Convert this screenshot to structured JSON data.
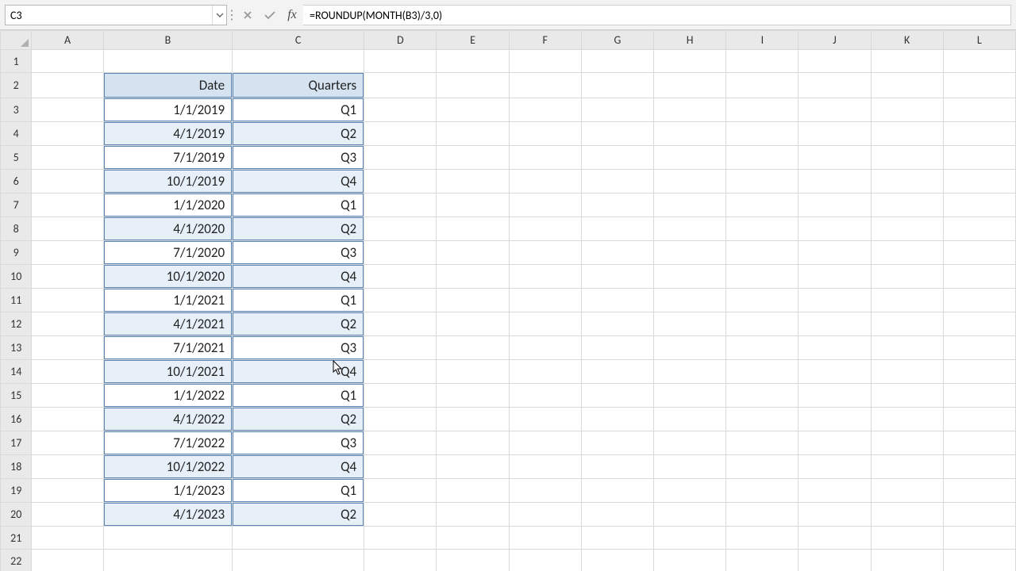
{
  "namebox": {
    "value": "C3"
  },
  "formula_bar": {
    "fx_label": "fx",
    "formula": "=ROUNDUP(MONTH(B3)/3,0)"
  },
  "columns": [
    "A",
    "B",
    "C",
    "D",
    "E",
    "F",
    "G",
    "H",
    "I",
    "J",
    "K",
    "L"
  ],
  "rows": [
    "1",
    "2",
    "3",
    "4",
    "5",
    "6",
    "7",
    "8",
    "9",
    "10",
    "11",
    "12",
    "13",
    "14",
    "15",
    "16",
    "17",
    "18",
    "19",
    "20",
    "21",
    "22"
  ],
  "table": {
    "headers": {
      "date": "Date",
      "quarters": "Quarters"
    },
    "rows": [
      {
        "date": "1/1/2019",
        "quarter": "Q1"
      },
      {
        "date": "4/1/2019",
        "quarter": "Q2"
      },
      {
        "date": "7/1/2019",
        "quarter": "Q3"
      },
      {
        "date": "10/1/2019",
        "quarter": "Q4"
      },
      {
        "date": "1/1/2020",
        "quarter": "Q1"
      },
      {
        "date": "4/1/2020",
        "quarter": "Q2"
      },
      {
        "date": "7/1/2020",
        "quarter": "Q3"
      },
      {
        "date": "10/1/2020",
        "quarter": "Q4"
      },
      {
        "date": "1/1/2021",
        "quarter": "Q1"
      },
      {
        "date": "4/1/2021",
        "quarter": "Q2"
      },
      {
        "date": "7/1/2021",
        "quarter": "Q3"
      },
      {
        "date": "10/1/2021",
        "quarter": "Q4"
      },
      {
        "date": "1/1/2022",
        "quarter": "Q1"
      },
      {
        "date": "4/1/2022",
        "quarter": "Q2"
      },
      {
        "date": "7/1/2022",
        "quarter": "Q3"
      },
      {
        "date": "10/1/2022",
        "quarter": "Q4"
      },
      {
        "date": "1/1/2023",
        "quarter": "Q1"
      },
      {
        "date": "4/1/2023",
        "quarter": "Q2"
      }
    ]
  }
}
